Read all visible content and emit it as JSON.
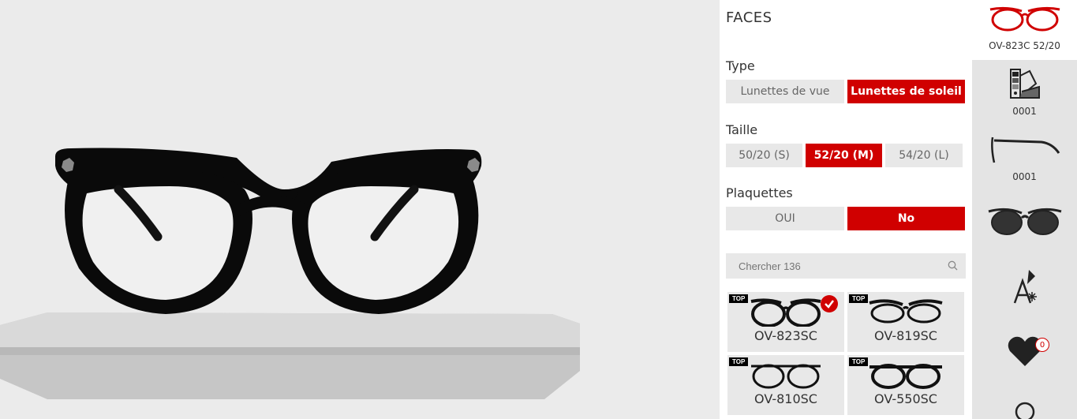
{
  "panel": {
    "brand": "FACES",
    "type": {
      "label": "Type",
      "options": [
        "Lunettes de vue",
        "Lunettes de soleil"
      ],
      "selected": "Lunettes de soleil"
    },
    "size": {
      "label": "Taille",
      "options": [
        "50/20 (S)",
        "52/20 (M)",
        "54/20 (L)"
      ],
      "selected": "52/20 (M)"
    },
    "pads": {
      "label": "Plaquettes",
      "options": [
        "OUI",
        "No"
      ],
      "selected": "No"
    },
    "search": {
      "placeholder": "Chercher 136"
    },
    "products": [
      {
        "name": "OV-823SC",
        "badge": "TOP",
        "selected": true
      },
      {
        "name": "OV-819SC",
        "badge": "TOP",
        "selected": false
      },
      {
        "name": "OV-810SC",
        "badge": "TOP",
        "selected": false
      },
      {
        "name": "OV-550SC",
        "badge": "TOP",
        "selected": false
      }
    ]
  },
  "rail": {
    "current_model": "OV-823C 52/20",
    "color_code": "0001",
    "temple_code": "0001",
    "favorites_count": "0"
  },
  "colors": {
    "accent": "#d00000",
    "chip_bg": "#e8e8e8",
    "viewer_bg": "#ebebeb"
  },
  "icons": [
    "search-icon",
    "color-palette-icon",
    "temple-icon",
    "sunglasses-icon",
    "engraving-icon",
    "heart-icon",
    "check-icon"
  ]
}
